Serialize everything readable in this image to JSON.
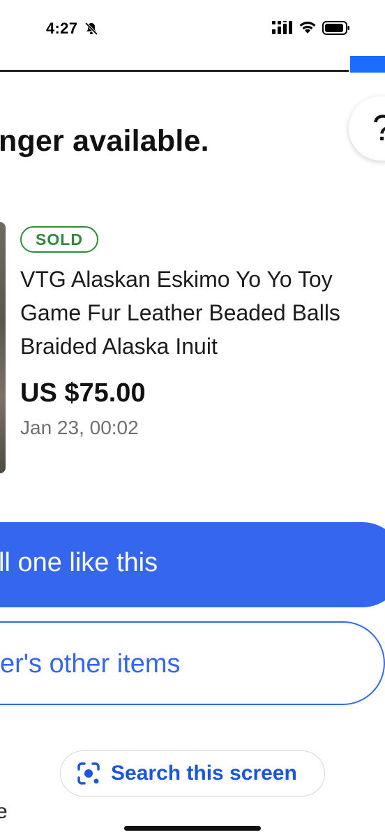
{
  "status_bar": {
    "time": "4:27",
    "icons": [
      "bell-slash-icon",
      "signal-icon",
      "wifi-icon",
      "battery-icon"
    ]
  },
  "header": {
    "accent_color": "#1a6dff"
  },
  "headline": "nger available.",
  "help": {
    "label": "?"
  },
  "item": {
    "badge": "SOLD",
    "badge_color": "#2f8a3b",
    "title": "VTG Alaskan Eskimo Yo Yo Toy Game Fur Leather Beaded Balls Braided Alaska Inuit",
    "price": "US $75.00",
    "date": "Jan 23, 00:02"
  },
  "actions": {
    "primary_label": "ll one like this",
    "secondary_label": "er's other items",
    "primary_color": "#3567ee"
  },
  "search_screen": {
    "label": "Search this screen",
    "icon": "lens-icon"
  },
  "bottom_partial_text": "e"
}
